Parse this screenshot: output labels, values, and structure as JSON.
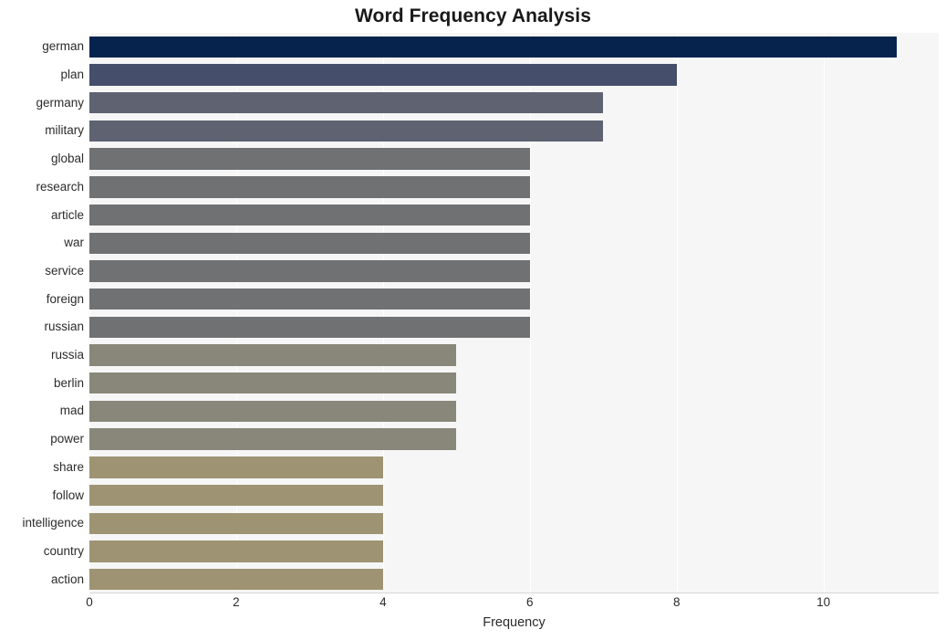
{
  "chart_data": {
    "type": "bar",
    "orientation": "horizontal",
    "title": "Word Frequency Analysis",
    "xlabel": "Frequency",
    "ylabel": "",
    "xlim": [
      0,
      11.57
    ],
    "xticks": [
      0,
      2,
      4,
      6,
      8,
      10
    ],
    "xtick_labels": [
      "0",
      "2",
      "4",
      "6",
      "8",
      "10"
    ],
    "grid": true,
    "grid_axis": "x",
    "legend": "none",
    "plot_background": "#f6f6f7",
    "categories": [
      "german",
      "plan",
      "germany",
      "military",
      "global",
      "research",
      "article",
      "war",
      "service",
      "foreign",
      "russian",
      "russia",
      "berlin",
      "mad",
      "power",
      "share",
      "follow",
      "intelligence",
      "country",
      "action"
    ],
    "values": [
      11,
      8,
      7,
      7,
      6,
      6,
      6,
      6,
      6,
      6,
      6,
      5,
      5,
      5,
      5,
      4,
      4,
      4,
      4,
      4
    ],
    "bar_colors": [
      "#05234d",
      "#454f6b",
      "#5e6271",
      "#5e6271",
      "#6f7173",
      "#6f7173",
      "#6f7173",
      "#6f7173",
      "#6f7173",
      "#6f7173",
      "#6f7173",
      "#888779",
      "#888779",
      "#888779",
      "#888779",
      "#9e9473",
      "#9e9473",
      "#9e9473",
      "#9e9473",
      "#9e9473"
    ]
  }
}
